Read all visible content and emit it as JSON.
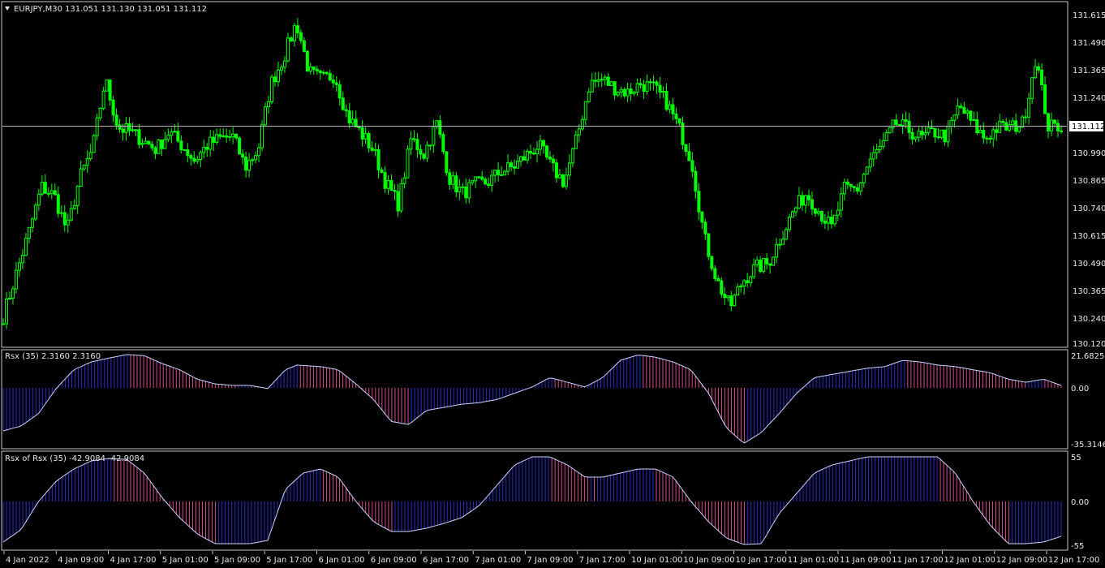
{
  "colors": {
    "background": "#000000",
    "frame": "#c8c8c8",
    "text": "#e6e6e6",
    "candle": "#00ff00",
    "bid_line": "#b4b4b4",
    "positive_bar": "#2b2bc8",
    "negative_bar": "#d0508c",
    "indicator_line": "#c8d2ff"
  },
  "main": {
    "symbol": "EURJPY,M30",
    "ohlc": "131.051 131.130 131.051 131.112",
    "current_price": "131.112",
    "price_labels": [
      "131.615",
      "131.490",
      "131.365",
      "131.240",
      "130.990",
      "130.865",
      "130.740",
      "130.615",
      "130.490",
      "130.365",
      "130.240",
      "130.120"
    ]
  },
  "rsx": {
    "label": "Rsx (35) 2.3160 2.3160",
    "scale_labels": [
      "21.6825",
      "0.00",
      "-35.3146"
    ]
  },
  "rsx_of_rsx": {
    "label": "Rsx of Rsx (35) -42.9084 -42.9084",
    "scale_labels": [
      "55",
      "0.00",
      "-55"
    ]
  },
  "time_labels": [
    "4 Jan 2022",
    "4 Jan 09:00",
    "4 Jan 17:00",
    "5 Jan 01:00",
    "5 Jan 09:00",
    "5 Jan 17:00",
    "6 Jan 01:00",
    "6 Jan 09:00",
    "6 Jan 17:00",
    "7 Jan 01:00",
    "7 Jan 09:00",
    "7 Jan 17:00",
    "10 Jan 01:00",
    "10 Jan 09:00",
    "10 Jan 17:00",
    "11 Jan 01:00",
    "11 Jan 09:00",
    "11 Jan 17:00",
    "12 Jan 01:00",
    "12 Jan 09:00",
    "12 Jan 17:00"
  ],
  "chart_data": [
    {
      "type": "candlestick",
      "symbol": "EURJPY",
      "timeframe": "M30",
      "ylim": [
        130.12,
        131.615
      ],
      "close_path": [
        [
          "4 Jan 2022",
          130.24
        ],
        [
          "4 Jan 01:30",
          130.43
        ],
        [
          "4 Jan 03:00",
          130.62
        ],
        [
          "4 Jan 04:30",
          130.83
        ],
        [
          "4 Jan 06:00",
          130.79
        ],
        [
          "4 Jan 07:30",
          130.63
        ],
        [
          "4 Jan 09:00",
          130.87
        ],
        [
          "4 Jan 11:00",
          131.0
        ],
        [
          "4 Jan 13:00",
          131.32
        ],
        [
          "4 Jan 15:00",
          131.1
        ],
        [
          "4 Jan 17:00",
          131.08
        ],
        [
          "4 Jan 19:00",
          131.04
        ],
        [
          "4 Jan 21:00",
          131.0
        ],
        [
          "4 Jan 23:00",
          131.08
        ],
        [
          "5 Jan 01:00",
          131.02
        ],
        [
          "5 Jan 03:00",
          130.95
        ],
        [
          "5 Jan 05:00",
          131.02
        ],
        [
          "5 Jan 07:00",
          131.05
        ],
        [
          "5 Jan 09:00",
          131.06
        ],
        [
          "5 Jan 11:00",
          130.92
        ],
        [
          "5 Jan 13:00",
          131.0
        ],
        [
          "5 Jan 15:00",
          131.3
        ],
        [
          "5 Jan 17:00",
          131.42
        ],
        [
          "5 Jan 18:30",
          131.58
        ],
        [
          "5 Jan 20:00",
          131.35
        ],
        [
          "5 Jan 22:00",
          131.32
        ],
        [
          "6 Jan 00:00",
          131.34
        ],
        [
          "6 Jan 01:00",
          131.15
        ],
        [
          "6 Jan 03:00",
          131.08
        ],
        [
          "6 Jan 05:00",
          131.0
        ],
        [
          "6 Jan 07:00",
          130.85
        ],
        [
          "6 Jan 09:00",
          130.75
        ],
        [
          "6 Jan 11:00",
          131.05
        ],
        [
          "6 Jan 13:00",
          130.98
        ],
        [
          "6 Jan 15:00",
          131.12
        ],
        [
          "6 Jan 17:00",
          130.87
        ],
        [
          "6 Jan 19:00",
          130.8
        ],
        [
          "6 Jan 21:00",
          130.84
        ],
        [
          "6 Jan 23:00",
          130.85
        ],
        [
          "7 Jan 01:00",
          130.9
        ],
        [
          "7 Jan 03:00",
          130.92
        ],
        [
          "7 Jan 05:00",
          130.97
        ],
        [
          "7 Jan 07:00",
          131.02
        ],
        [
          "7 Jan 09:00",
          130.92
        ],
        [
          "7 Jan 11:00",
          130.85
        ],
        [
          "7 Jan 13:00",
          131.05
        ],
        [
          "7 Jan 15:00",
          131.3
        ],
        [
          "7 Jan 17:00",
          131.32
        ],
        [
          "7 Jan 19:00",
          131.28
        ],
        [
          "7 Jan 21:00",
          131.26
        ],
        [
          "7 Jan 23:00",
          131.3
        ],
        [
          "10 Jan 01:00",
          131.28
        ],
        [
          "10 Jan 03:00",
          131.22
        ],
        [
          "10 Jan 05:00",
          131.1
        ],
        [
          "10 Jan 07:00",
          130.95
        ],
        [
          "10 Jan 09:00",
          130.6
        ],
        [
          "10 Jan 11:00",
          130.4
        ],
        [
          "10 Jan 13:00",
          130.28
        ],
        [
          "10 Jan 15:00",
          130.4
        ],
        [
          "10 Jan 17:00",
          130.46
        ],
        [
          "10 Jan 19:00",
          130.48
        ],
        [
          "10 Jan 21:00",
          130.6
        ],
        [
          "10 Jan 23:00",
          130.72
        ],
        [
          "11 Jan 01:00",
          130.8
        ],
        [
          "11 Jan 03:00",
          130.72
        ],
        [
          "11 Jan 05:00",
          130.64
        ],
        [
          "11 Jan 07:00",
          130.82
        ],
        [
          "11 Jan 09:00",
          130.82
        ],
        [
          "11 Jan 11:00",
          130.95
        ],
        [
          "11 Jan 13:00",
          131.02
        ],
        [
          "11 Jan 15:00",
          131.12
        ],
        [
          "11 Jan 17:00",
          131.09
        ],
        [
          "11 Jan 19:00",
          131.05
        ],
        [
          "11 Jan 21:00",
          131.08
        ],
        [
          "11 Jan 23:00",
          131.06
        ],
        [
          "12 Jan 01:00",
          131.2
        ],
        [
          "12 Jan 03:00",
          131.12
        ],
        [
          "12 Jan 05:00",
          131.05
        ],
        [
          "12 Jan 07:00",
          131.1
        ],
        [
          "12 Jan 09:00",
          131.1
        ],
        [
          "12 Jan 11:00",
          131.12
        ],
        [
          "12 Jan 13:00",
          131.42
        ],
        [
          "12 Jan 15:00",
          131.1
        ],
        [
          "12 Jan 17:00",
          131.11
        ]
      ]
    },
    {
      "type": "histogram",
      "name": "Rsx (35)",
      "ylim": [
        -35.3146,
        21.6825
      ],
      "points": [
        [
          0,
          -27
        ],
        [
          3,
          -24
        ],
        [
          6,
          -16
        ],
        [
          9,
          0
        ],
        [
          12,
          12
        ],
        [
          15,
          17
        ],
        [
          18,
          19.5
        ],
        [
          21,
          21.7
        ],
        [
          24,
          21
        ],
        [
          27,
          16
        ],
        [
          30,
          12
        ],
        [
          33,
          6
        ],
        [
          36,
          3
        ],
        [
          39,
          2
        ],
        [
          42,
          2
        ],
        [
          45,
          0
        ],
        [
          48,
          12
        ],
        [
          50,
          15
        ],
        [
          54,
          14
        ],
        [
          57,
          12
        ],
        [
          60,
          3
        ],
        [
          63,
          -7
        ],
        [
          66,
          -21
        ],
        [
          69,
          -23
        ],
        [
          72,
          -14
        ],
        [
          75,
          -12
        ],
        [
          78,
          -10
        ],
        [
          81,
          -9
        ],
        [
          84,
          -7
        ],
        [
          87,
          -3
        ],
        [
          90,
          1
        ],
        [
          93,
          7
        ],
        [
          96,
          4
        ],
        [
          99,
          1
        ],
        [
          102,
          7
        ],
        [
          105,
          18
        ],
        [
          108,
          21.5
        ],
        [
          111,
          20
        ],
        [
          114,
          17
        ],
        [
          117,
          12
        ],
        [
          120,
          -3
        ],
        [
          123,
          -25
        ],
        [
          126,
          -35
        ],
        [
          129,
          -28
        ],
        [
          132,
          -16
        ],
        [
          135,
          -3
        ],
        [
          138,
          7
        ],
        [
          141,
          9
        ],
        [
          144,
          11
        ],
        [
          147,
          13
        ],
        [
          150,
          14
        ],
        [
          153,
          18
        ],
        [
          156,
          17
        ],
        [
          159,
          15
        ],
        [
          162,
          14
        ],
        [
          165,
          12
        ],
        [
          168,
          10
        ],
        [
          171,
          6
        ],
        [
          174,
          4
        ],
        [
          177,
          6
        ],
        [
          180,
          2
        ]
      ]
    },
    {
      "type": "histogram",
      "name": "Rsx of Rsx (35)",
      "ylim": [
        -55,
        55
      ],
      "points": [
        [
          0,
          -50
        ],
        [
          3,
          -35
        ],
        [
          6,
          0
        ],
        [
          9,
          25
        ],
        [
          12,
          40
        ],
        [
          15,
          50
        ],
        [
          18,
          53
        ],
        [
          21,
          52
        ],
        [
          24,
          35
        ],
        [
          27,
          5
        ],
        [
          30,
          -20
        ],
        [
          33,
          -40
        ],
        [
          36,
          -52
        ],
        [
          39,
          -52
        ],
        [
          42,
          -52
        ],
        [
          45,
          -48
        ],
        [
          48,
          15
        ],
        [
          51,
          35
        ],
        [
          54,
          40
        ],
        [
          57,
          30
        ],
        [
          60,
          0
        ],
        [
          63,
          -25
        ],
        [
          66,
          -37
        ],
        [
          69,
          -37
        ],
        [
          72,
          -33
        ],
        [
          75,
          -27
        ],
        [
          78,
          -20
        ],
        [
          81,
          -5
        ],
        [
          84,
          20
        ],
        [
          87,
          45
        ],
        [
          90,
          55
        ],
        [
          93,
          55
        ],
        [
          96,
          45
        ],
        [
          99,
          30
        ],
        [
          102,
          30
        ],
        [
          105,
          35
        ],
        [
          108,
          40
        ],
        [
          111,
          40
        ],
        [
          114,
          30
        ],
        [
          117,
          0
        ],
        [
          120,
          -25
        ],
        [
          123,
          -45
        ],
        [
          126,
          -53
        ],
        [
          129,
          -52
        ],
        [
          132,
          -15
        ],
        [
          135,
          10
        ],
        [
          138,
          35
        ],
        [
          141,
          45
        ],
        [
          144,
          50
        ],
        [
          147,
          55
        ],
        [
          150,
          55
        ],
        [
          153,
          55
        ],
        [
          156,
          55
        ],
        [
          159,
          55
        ],
        [
          162,
          35
        ],
        [
          165,
          0
        ],
        [
          168,
          -30
        ],
        [
          171,
          -52
        ],
        [
          174,
          -52
        ],
        [
          177,
          -50
        ],
        [
          180,
          -43
        ]
      ]
    }
  ]
}
